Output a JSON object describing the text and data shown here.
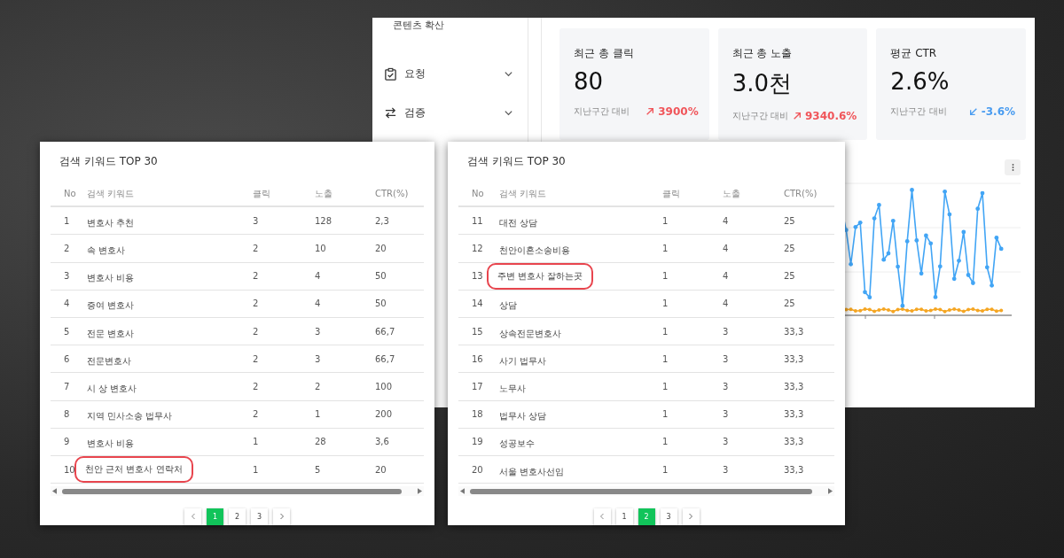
{
  "sidebar": {
    "items": [
      {
        "label": "콘텐츠 확산",
        "kind": "plain"
      },
      {
        "label": "요청",
        "kind": "group"
      },
      {
        "label": "검증",
        "kind": "group"
      }
    ]
  },
  "stats": [
    {
      "label": "최근 총 클릭",
      "value": "80",
      "compare_label": "지난구간 대비",
      "change": "3900%",
      "kind": "up"
    },
    {
      "label": "최근 총 노출",
      "value": "3.0천",
      "compare_label": "지난구간 대비",
      "change": "9340.6%",
      "kind": "up"
    },
    {
      "label": "평균 CTR",
      "value": "2.6%",
      "compare_label": "지난구간 대비",
      "change": "-3.6%",
      "kind": "down"
    }
  ],
  "tables": [
    {
      "title": "검색 키워드 TOP 30",
      "columns": [
        "No",
        "검색 키워드",
        "클릭",
        "노출",
        "CTR(%)"
      ],
      "rows": [
        {
          "no": "1",
          "keyword": "변호사 추천",
          "clicks": "3",
          "impressions": "128",
          "ctr": "2,3",
          "highlighted": false
        },
        {
          "no": "2",
          "keyword": "속 변호사",
          "clicks": "2",
          "impressions": "10",
          "ctr": "20",
          "highlighted": false
        },
        {
          "no": "3",
          "keyword": "변호사 비용",
          "clicks": "2",
          "impressions": "4",
          "ctr": "50",
          "highlighted": false
        },
        {
          "no": "4",
          "keyword": "증여 변호사",
          "clicks": "2",
          "impressions": "4",
          "ctr": "50",
          "highlighted": false
        },
        {
          "no": "5",
          "keyword": "전문 변호사",
          "clicks": "2",
          "impressions": "3",
          "ctr": "66,7",
          "highlighted": false
        },
        {
          "no": "6",
          "keyword": "전문변호사",
          "clicks": "2",
          "impressions": "3",
          "ctr": "66,7",
          "highlighted": false
        },
        {
          "no": "7",
          "keyword": "시 상 변호사",
          "clicks": "2",
          "impressions": "2",
          "ctr": "100",
          "highlighted": false
        },
        {
          "no": "8",
          "keyword": "지역 민사소송 법무사",
          "clicks": "2",
          "impressions": "1",
          "ctr": "200",
          "highlighted": false
        },
        {
          "no": "9",
          "keyword": "변호사 비용",
          "clicks": "1",
          "impressions": "28",
          "ctr": "3,6",
          "highlighted": false
        },
        {
          "no": "10",
          "keyword": "천안 근처 변호사 연락처",
          "clicks": "1",
          "impressions": "5",
          "ctr": "20",
          "highlighted": true
        }
      ],
      "pages": [
        {
          "label": "1",
          "selected": true
        },
        {
          "label": "2",
          "selected": false
        },
        {
          "label": "3",
          "selected": false
        }
      ]
    },
    {
      "title": "검색 키워드 TOP 30",
      "columns": [
        "No",
        "검색 키워드",
        "클릭",
        "노출",
        "CTR(%)"
      ],
      "rows": [
        {
          "no": "11",
          "keyword": "대전 상담",
          "clicks": "1",
          "impressions": "4",
          "ctr": "25",
          "highlighted": false
        },
        {
          "no": "12",
          "keyword": "천안이혼소송비용",
          "clicks": "1",
          "impressions": "4",
          "ctr": "25",
          "highlighted": false
        },
        {
          "no": "13",
          "keyword": "주변 변호사 잘하는곳",
          "clicks": "1",
          "impressions": "4",
          "ctr": "25",
          "highlighted": true
        },
        {
          "no": "14",
          "keyword": "상담",
          "clicks": "1",
          "impressions": "4",
          "ctr": "25",
          "highlighted": false
        },
        {
          "no": "15",
          "keyword": "상속전문변호사",
          "clicks": "1",
          "impressions": "3",
          "ctr": "33,3",
          "highlighted": false
        },
        {
          "no": "16",
          "keyword": "사기 법무사",
          "clicks": "1",
          "impressions": "3",
          "ctr": "33,3",
          "highlighted": false
        },
        {
          "no": "17",
          "keyword": "노무사",
          "clicks": "1",
          "impressions": "3",
          "ctr": "33,3",
          "highlighted": false
        },
        {
          "no": "18",
          "keyword": "법무사 상담",
          "clicks": "1",
          "impressions": "3",
          "ctr": "33,3",
          "highlighted": false
        },
        {
          "no": "19",
          "keyword": "성공보수",
          "clicks": "1",
          "impressions": "3",
          "ctr": "33,3",
          "highlighted": false
        },
        {
          "no": "20",
          "keyword": "서울 변호사선임",
          "clicks": "1",
          "impressions": "3",
          "ctr": "33,3",
          "highlighted": false
        }
      ],
      "pages": [
        {
          "label": "1",
          "selected": false
        },
        {
          "label": "2",
          "selected": true
        },
        {
          "label": "3",
          "selected": false
        }
      ]
    }
  ]
}
